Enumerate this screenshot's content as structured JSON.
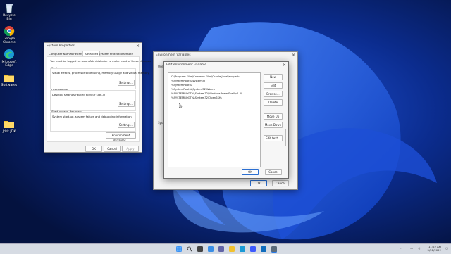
{
  "desktop": {
    "icons": [
      {
        "label": "Recycle Bin",
        "icon": "recycle-bin-icon"
      },
      {
        "label": "Google Chrome",
        "icon": "chrome-icon"
      },
      {
        "label": "Microsoft Edge",
        "icon": "edge-icon"
      },
      {
        "label": "Softwares",
        "icon": "folder-icon"
      },
      {
        "label": "Jdsk JDK",
        "icon": "folder-icon"
      }
    ]
  },
  "system_properties": {
    "title": "System Properties",
    "tabs": [
      "Computer Name",
      "Hardware",
      "Advanced",
      "System Protection",
      "Remote"
    ],
    "active_tab": "Advanced",
    "admin_note": "You must be logged on as an Administrator to make most of these changes",
    "performance": {
      "title": "Performance",
      "desc": "Visual effects, processor scheduling, memory usage and virtual memory",
      "button": "Settings..."
    },
    "user_profiles": {
      "title": "User Profiles",
      "desc": "Desktop settings related to your sign-in",
      "button": "Settings..."
    },
    "startup_recovery": {
      "title": "Start-up and Recovery",
      "desc": "System start-up, system failure and debugging information",
      "button": "Settings..."
    },
    "env_button": "Environment Variables...",
    "ok": "OK",
    "cancel": "Cancel",
    "apply": "Apply"
  },
  "env_vars": {
    "title": "Environment Variables",
    "user_label": "User",
    "system_label": "Syst",
    "ok": "OK",
    "cancel": "Cancel"
  },
  "edit_env": {
    "title": "Edit environment variable",
    "paths": [
      "C:\\Program Files\\Common Files\\Oracle\\Java\\javapath",
      "%SystemRoot%\\system32",
      "%SystemRoot%",
      "%SystemRoot%\\System32\\Wbem",
      "%SYSTEMROOT%\\System32\\WindowsPowerShell\\v1.0\\",
      "%SYSTEMROOT%\\System32\\OpenSSH\\"
    ],
    "buttons": {
      "new": "New",
      "edit": "Edit",
      "browse": "Browse...",
      "delete": "Delete",
      "move_up": "Move Up",
      "move_down": "Move Down",
      "edit_text": "Edit text..."
    },
    "ok": "OK",
    "cancel": "Cancel"
  },
  "taskbar": {
    "apps": [
      "windows-start-icon",
      "search-icon",
      "task-view-icon",
      "widgets-icon",
      "chat-icon",
      "file-explorer-icon",
      "edge-icon",
      "store-icon",
      "mail-icon",
      "system-properties-icon"
    ],
    "time": "11:22 AM",
    "date": "5/28/2022"
  },
  "colors": {
    "wallpaper": "#0a2a8a",
    "accent": "#2c6fd1",
    "taskbar": "#d6dbe3"
  }
}
